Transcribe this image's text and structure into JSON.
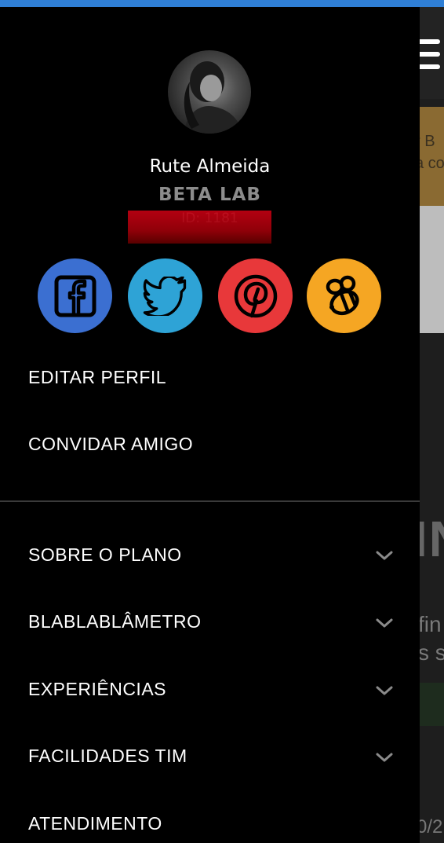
{
  "background_page": {
    "banner_lines": [
      "r B",
      "a co"
    ],
    "big_text": "IN",
    "side_lines": [
      "fin",
      "s s"
    ],
    "date_fragment": "0/2"
  },
  "profile": {
    "name": "Rute Almeida",
    "plan": "BETA LAB",
    "id_text": "ID: 1181"
  },
  "social": [
    {
      "name": "facebook",
      "icon": "facebook-icon",
      "color": "#3b6fd1"
    },
    {
      "name": "twitter",
      "icon": "twitter-icon",
      "color": "#2ea3d6"
    },
    {
      "name": "pinterest",
      "icon": "pinterest-icon",
      "color": "#e8383a"
    },
    {
      "name": "bee",
      "icon": "bee-icon",
      "color": "#f5a623"
    }
  ],
  "menu": {
    "edit_profile": "EDITAR PERFIL",
    "invite_friend": "CONVIDAR AMIGO",
    "sections": [
      {
        "label": "SOBRE O PLANO",
        "expandable": true
      },
      {
        "label": "BLABLABLÂMETRO",
        "expandable": true
      },
      {
        "label": "EXPERIÊNCIAS",
        "expandable": true
      },
      {
        "label": "FACILIDADES TIM",
        "expandable": true
      },
      {
        "label": "ATENDIMENTO",
        "expandable": false
      }
    ]
  },
  "colors": {
    "drawer_bg": "#000000",
    "top_accent": "#2f7fd6"
  }
}
